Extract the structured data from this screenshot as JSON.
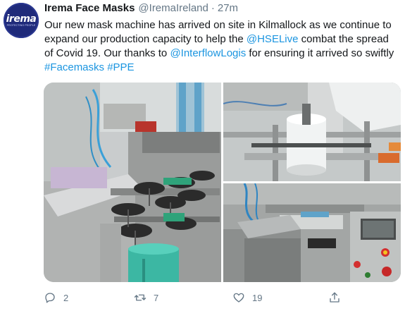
{
  "profile": {
    "display_name": "Irema Face Masks",
    "handle": "@IremaIreland",
    "separator": "·",
    "timestamp": "27m",
    "avatar": {
      "logo_text": "irema",
      "tagline": "PROTECTING PEOPLE"
    }
  },
  "tweet": {
    "text_parts": [
      "Our new mask machine has arrived on site in Kilmallock as we continue to expand our production capacity to help the ",
      " combat the spread of Covid 19.  Our thanks to ",
      " for ensuring it arrived so swiftly "
    ],
    "mentions": [
      "@HSELive",
      "@InterflowLogis"
    ],
    "hashtags": [
      "#Facemasks",
      "#PPE"
    ]
  },
  "media": {
    "photos": [
      {
        "name": "Mask machine with handwheels and green roll"
      },
      {
        "name": "White fabric roll on machine"
      },
      {
        "name": "Machine control panel with buttons"
      }
    ]
  },
  "actions": {
    "reply_count": "2",
    "retweet_count": "7",
    "like_count": "19",
    "icons": [
      "reply-icon",
      "retweet-icon",
      "like-icon",
      "share-icon"
    ]
  },
  "colors": {
    "link": "#1b95e0",
    "text": "#14171a",
    "secondary": "#657786",
    "avatar_bg": "#1f2a7a"
  }
}
